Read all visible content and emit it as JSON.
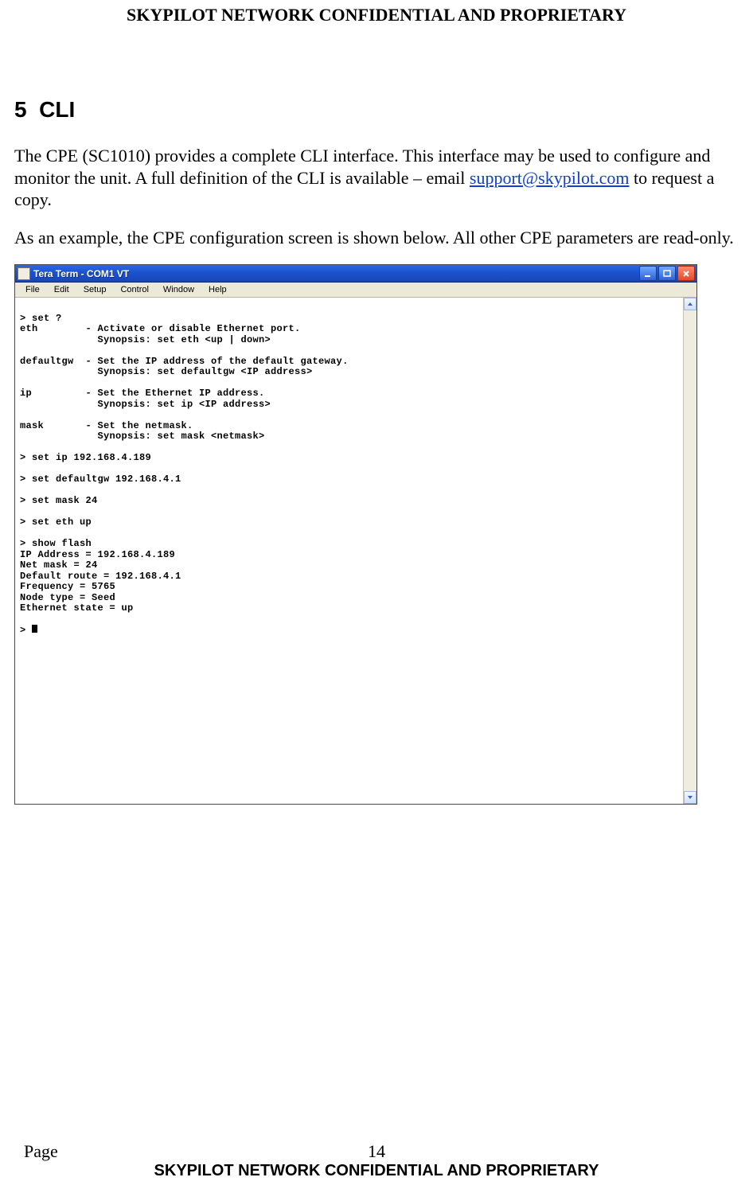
{
  "doc": {
    "header": "SKYPILOT NETWORK CONFIDENTIAL AND PROPRIETARY",
    "section_number": "5",
    "section_title": "CLI",
    "para1_a": "The CPE (SC1010) provides a complete CLI interface. This interface may be used to configure and monitor the unit. A full definition of the CLI is available – email ",
    "support_email": "support@skypilot.com",
    "para1_b": " to request a copy.",
    "para2": "As an example, the CPE configuration screen is shown below. All other CPE parameters are read-only.",
    "footer_page_label": "Page",
    "footer_page_num": "14",
    "footer_banner": "SKYPILOT NETWORK CONFIDENTIAL AND PROPRIETARY"
  },
  "window": {
    "title": "Tera Term - COM1 VT",
    "menus": [
      "File",
      "Edit",
      "Setup",
      "Control",
      "Window",
      "Help"
    ]
  },
  "terminal": {
    "lines": [
      "",
      "> set ?",
      "eth        - Activate or disable Ethernet port.",
      "             Synopsis: set eth <up | down>",
      "",
      "defaultgw  - Set the IP address of the default gateway.",
      "             Synopsis: set defaultgw <IP address>",
      "",
      "ip         - Set the Ethernet IP address.",
      "             Synopsis: set ip <IP address>",
      "",
      "mask       - Set the netmask.",
      "             Synopsis: set mask <netmask>",
      "",
      "> set ip 192.168.4.189",
      "",
      "> set defaultgw 192.168.4.1",
      "",
      "> set mask 24",
      "",
      "> set eth up",
      "",
      "> show flash",
      "IP Address = 192.168.4.189",
      "Net mask = 24",
      "Default route = 192.168.4.1",
      "Frequency = 5765",
      "Node type = Seed",
      "Ethernet state = up",
      "",
      "> "
    ]
  }
}
